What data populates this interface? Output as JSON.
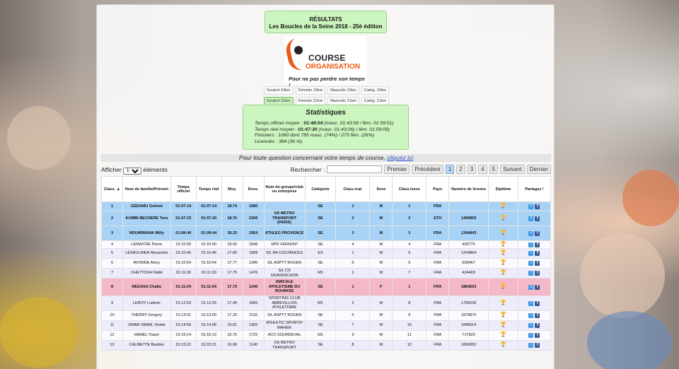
{
  "header": {
    "title_line1": "RÉSULTATS",
    "title_line2": "Les Boucles de la Seine 2018 - 25è édition"
  },
  "logo": {
    "line1": "COURSE",
    "line2": "ORGANISATION",
    "tagline": "Pour ne pas perdre son temps !"
  },
  "filters": {
    "row1": [
      "Scratch 10km",
      "Féminin 10km",
      "Masculin 10km",
      "Catég. 10km"
    ],
    "row2": [
      "Scratch 21km",
      "Féminin 21km",
      "Masculin 21km",
      "Catég. 21km"
    ],
    "active": "Scratch 21km"
  },
  "stats": {
    "title": "Statistiques",
    "line1_pre": "Temps officiel moyen : ",
    "line1_bold": "01:48:04",
    "line1_post": " (masc. 01:43:56 / fém. 01:59:51)",
    "line2_pre": "Temps réel moyen : ",
    "line2_bold": "01:47:30",
    "line2_post": " (masc. 01:43:26) / fém. 01:59:09)",
    "line3": "Finishers : 1060 dont 785 masc. (74%) / 275 fém. (26%)",
    "line4": "Licenciés : 384 (36 %)"
  },
  "contact": {
    "text": "Pour toute question concernant votre temps de course, ",
    "link": "cliquez ici"
  },
  "controls": {
    "show_label": "Afficher",
    "show_value": "100",
    "entries_label": "éléments",
    "search_label": "Rechercher :",
    "search_value": "",
    "first": "Premier",
    "prev": "Précédent",
    "pages": [
      "1",
      "2",
      "3",
      "4",
      "5"
    ],
    "current_page": "1",
    "next": "Suivant",
    "last": "Dernier"
  },
  "table": {
    "headers": [
      "Class. ▲",
      "Nom de famille/Prénom",
      "Temps officiel",
      "Temps réel",
      "Moy.",
      "Doss.",
      "Nom du groupe/club ou entreprise",
      "Catégorie",
      "Class./cat.",
      "Sexe",
      "Class./sexe",
      "Pays",
      "Numéro de licence",
      "Diplôme",
      "Partagez !"
    ],
    "rows": [
      {
        "style": "top",
        "cells": [
          "1",
          "GEDAMU Getinet",
          "01:07:14",
          "01:07:14",
          "18.74",
          "1680",
          "",
          "SE",
          "1",
          "M",
          "1",
          "FRA",
          ""
        ]
      },
      {
        "style": "top",
        "cells": [
          "2",
          "KUMBI BECHERE Tura",
          "01:07:23",
          "01:07:20",
          "18.70",
          "2206",
          "US METRO TRANSPORT (PARIS)",
          "SE",
          "2",
          "M",
          "2",
          "ETH",
          "1490859"
        ]
      },
      {
        "style": "top",
        "cells": [
          "3",
          "NDUWIMANA Willy",
          "01:08:44",
          "01:08:44",
          "18.33",
          "1954",
          "ATHLEG PROVENCE",
          "SE",
          "3",
          "M",
          "3",
          "FRA",
          "1344843"
        ]
      },
      {
        "style": "even",
        "cells": [
          "4",
          "LEMAITRE Pierre",
          "01:10:00",
          "01:10:00",
          "18.00",
          "1848",
          "SPN VERNON*",
          "SE",
          "4",
          "M",
          "4",
          "FRA",
          "409775"
        ]
      },
      {
        "style": "odd",
        "cells": [
          "5",
          "LESAULNIER Alexandre",
          "01:10:46",
          "01:10:46",
          "17.80",
          "1868",
          "S/L BA COUTANCES",
          "ES",
          "1",
          "M",
          "5",
          "FRA",
          "1204864"
        ]
      },
      {
        "style": "even",
        "cells": [
          "6",
          "AVONDE Alexy",
          "01:10:54",
          "01:10:54",
          "17.77",
          "1345",
          "S/L ASPTT ROUEN",
          "SE",
          "5",
          "M",
          "6",
          "FRA",
          "600467"
        ]
      },
      {
        "style": "odd",
        "cells": [
          "7",
          "CHETTOUH Nabil",
          "01:11:00",
          "01:11:00",
          "17.75",
          "1476",
          "S/L CS GRAVENCHON",
          "M1",
          "1",
          "M",
          "7",
          "FRA",
          "424469"
        ]
      },
      {
        "style": "fem",
        "cells": [
          "8",
          "NEGASA Chaltu",
          "01:11:04",
          "01:11:04",
          "17.73",
          "1240",
          "AMICALE ATHLETISME DU ROUMOIS",
          "SE",
          "1",
          "F",
          "1",
          "FRA",
          "1864203"
        ]
      },
      {
        "style": "odd",
        "cells": [
          "9",
          "LEROY Ludovic",
          "01:12:03",
          "01:12:03",
          "17.49",
          "1866",
          "SPORTING CLUB ABBEVILLOIS ATHLETISME",
          "M1",
          "2",
          "M",
          "8",
          "FRA",
          "1766038"
        ]
      },
      {
        "style": "even",
        "cells": [
          "10",
          "THERRY Gregory",
          "01:13:01",
          "01:13:00",
          "17.26",
          "2116",
          "S/L ASPTT ROUEN",
          "SE",
          "6",
          "M",
          "9",
          "FRA",
          "1879875"
        ]
      },
      {
        "style": "odd",
        "cells": [
          "11",
          "OMAR ISMAIL Shakir",
          "01:14:58",
          "01:14:58",
          "16.81",
          "1965",
          "ATHLETIC SPORTIF MAHER",
          "SE",
          "7",
          "M",
          "10",
          "FRA",
          "1848314"
        ]
      },
      {
        "style": "even",
        "cells": [
          "12",
          "HAMEL Yoann",
          "01:15:14",
          "01:15:13",
          "16.75",
          "1722",
          "ACO SOURDEVAL",
          "M1",
          "3",
          "M",
          "11",
          "FRA",
          "717820"
        ]
      },
      {
        "style": "odd",
        "cells": [
          "13",
          "CALMETTE Bastien",
          "01:15:22",
          "01:15:21",
          "16.68",
          "1140",
          "US METRO TRANSPORT",
          "SE",
          "8",
          "M",
          "12",
          "FRA",
          "1866062"
        ]
      }
    ]
  },
  "icons": {
    "trophy": "🏆",
    "twitter": "t",
    "facebook": "f"
  },
  "colors": {
    "top_row": "#a8d3f6",
    "female_row": "#f4b8c8",
    "stats_bg": "#ccf5bf",
    "link": "#2a55c8",
    "brand_orange": "#e85a16"
  }
}
